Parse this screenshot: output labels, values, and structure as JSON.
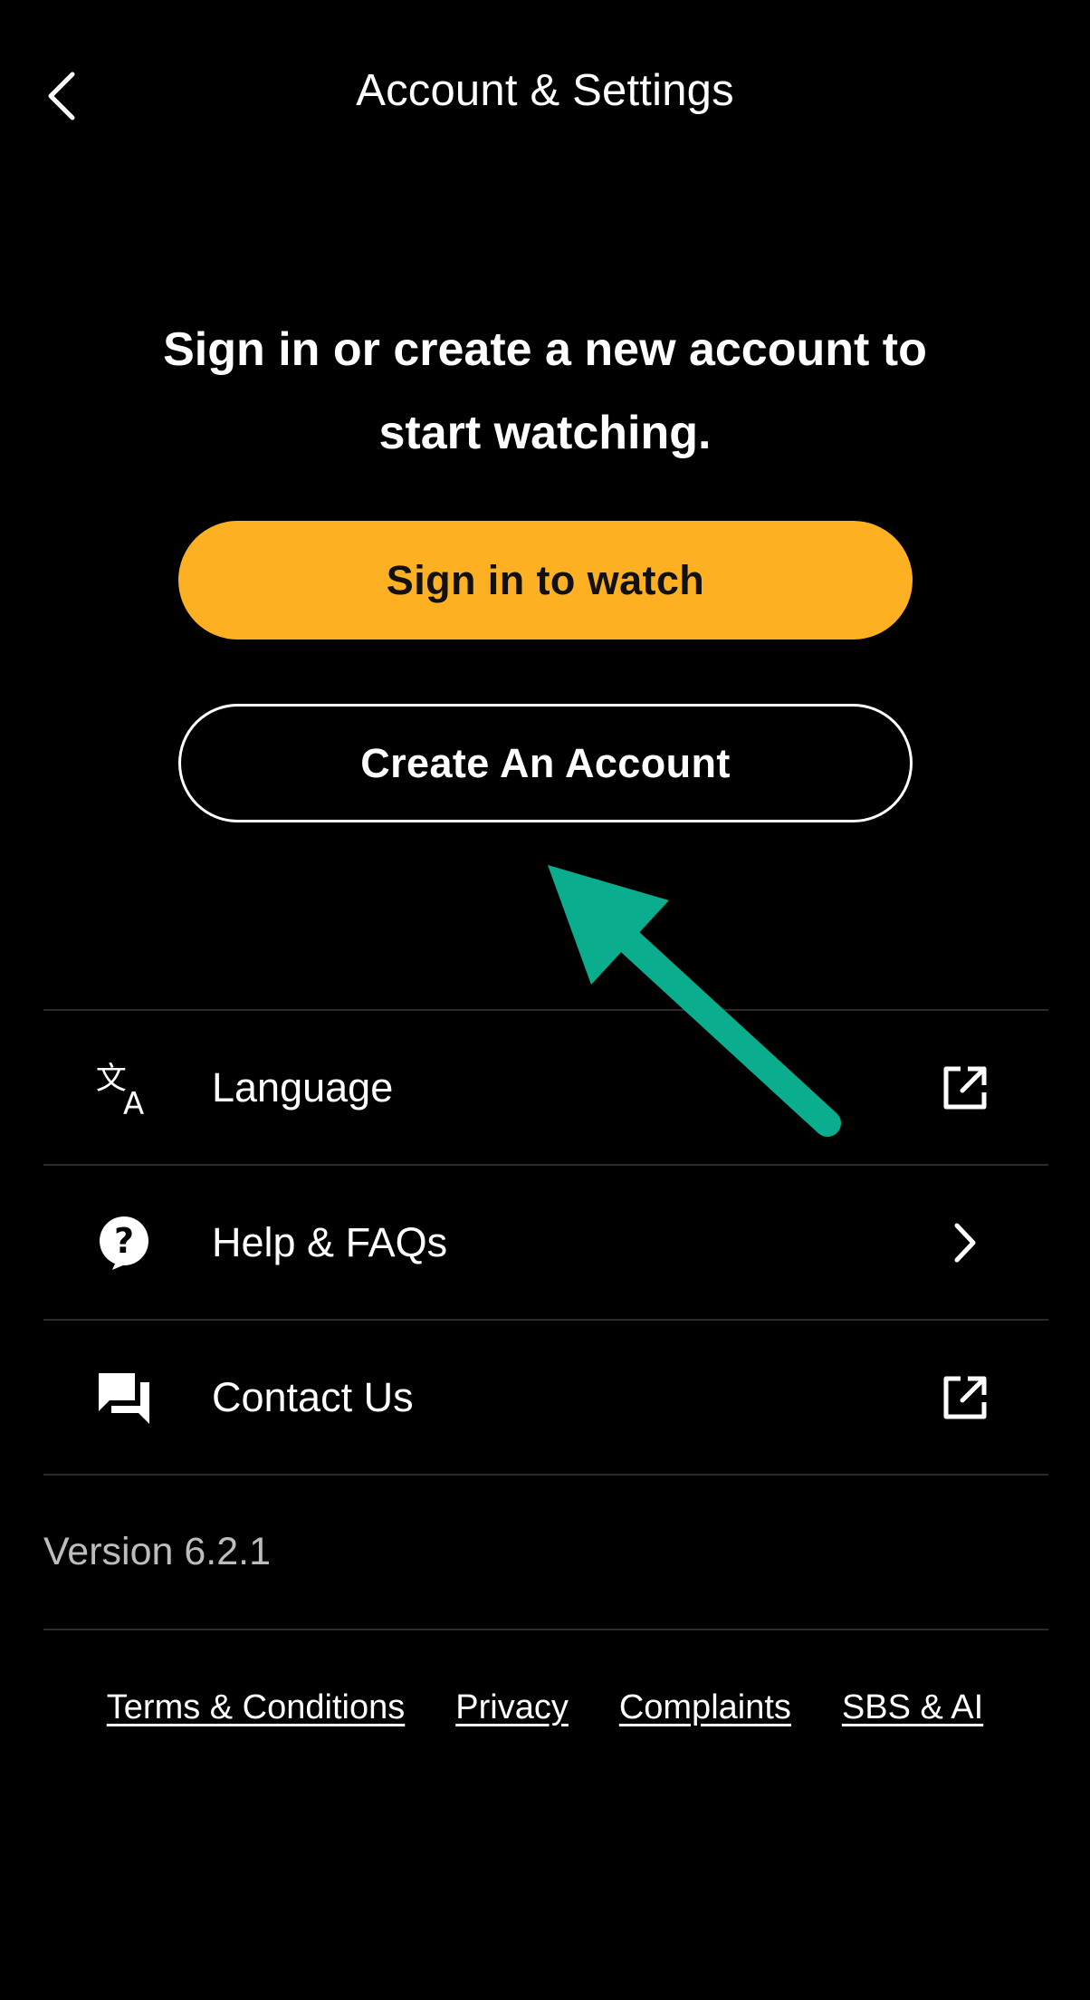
{
  "header": {
    "title": "Account & Settings",
    "back_icon": "chevron-left-icon"
  },
  "main": {
    "prompt": "Sign in or create a new account to start watching.",
    "signin_label": "Sign in to watch",
    "create_label": "Create An Account"
  },
  "menu": {
    "items": [
      {
        "label": "Language",
        "icon": "translate-icon",
        "trail": "external-link-icon"
      },
      {
        "label": "Help & FAQs",
        "icon": "help-circle-icon",
        "trail": "chevron-right-icon"
      },
      {
        "label": "Contact Us",
        "icon": "chat-bubbles-icon",
        "trail": "external-link-icon"
      }
    ],
    "version": "Version 6.2.1"
  },
  "footer": {
    "links": [
      "Terms & Conditions",
      "Privacy",
      "Complaints",
      "SBS & AI"
    ]
  },
  "colors": {
    "background": "#000000",
    "accent": "#FDB022",
    "annotation_arrow": "#0AAE8E"
  }
}
